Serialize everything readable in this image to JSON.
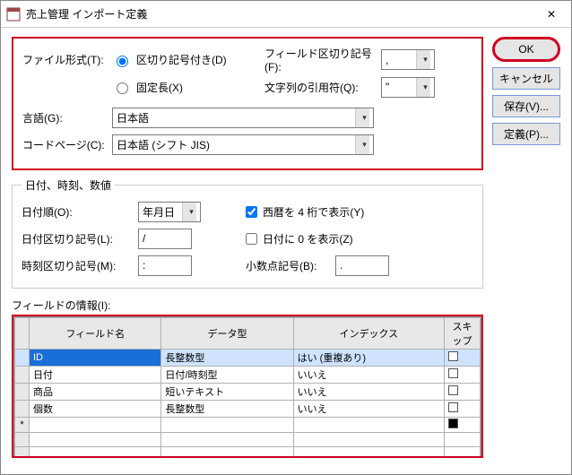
{
  "window": {
    "title": "売上管理 インポート定義",
    "close_label": "✕"
  },
  "buttons": {
    "ok": "OK",
    "cancel": "キャンセル",
    "save": "保存(V)...",
    "define": "定義(P)..."
  },
  "top": {
    "file_format_label": "ファイル形式(T):",
    "radio_delimited": "区切り記号付き(D)",
    "radio_fixed": "固定長(X)",
    "field_delim_label": "フィールド区切り記号(F):",
    "field_delim_value": ",",
    "text_qualifier_label": "文字列の引用符(Q):",
    "text_qualifier_value": "\"",
    "language_label": "言語(G):",
    "language_value": "日本語",
    "codepage_label": "コードページ(C):",
    "codepage_value": "日本語 (シフト JIS)"
  },
  "dt": {
    "legend": "日付、時刻、数値",
    "date_order_label": "日付順(O):",
    "date_order_value": "年月日",
    "four_digit_label": "西暦を 4 桁で表示(Y)",
    "date_delim_label": "日付区切り記号(L):",
    "date_delim_value": "/",
    "leading_zero_label": "日付に 0 を表示(Z)",
    "time_delim_label": "時刻区切り記号(M):",
    "time_delim_value": ":",
    "decimal_label": "小数点記号(B):",
    "decimal_value": "."
  },
  "fields": {
    "label": "フィールドの情報(I):",
    "headers": {
      "name": "フィールド名",
      "type": "データ型",
      "index": "インデックス",
      "skip": "スキップ"
    },
    "rows": [
      {
        "name": "ID",
        "type": "長整数型",
        "index": "はい (重複あり)"
      },
      {
        "name": "日付",
        "type": "日付/時刻型",
        "index": "いいえ"
      },
      {
        "name": "商品",
        "type": "短いテキスト",
        "index": "いいえ"
      },
      {
        "name": "個数",
        "type": "長整数型",
        "index": "いいえ"
      }
    ]
  }
}
